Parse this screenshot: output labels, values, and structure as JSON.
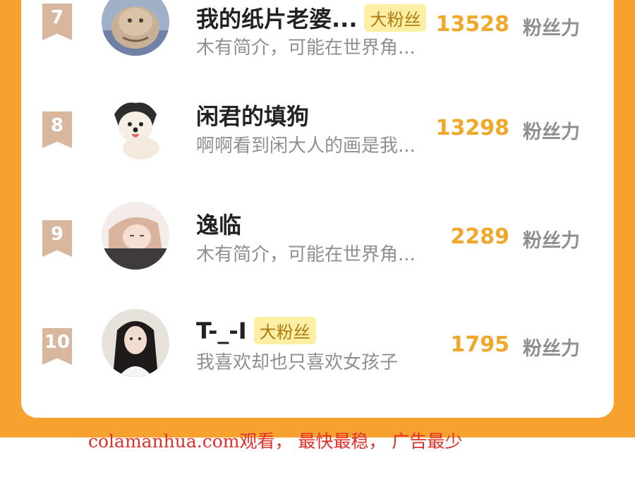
{
  "colors": {
    "frame": "#f7a12e",
    "score": "#f0a82a",
    "rank_tag": "#d8b79e",
    "badge_bg": "#fcefa4",
    "footer_text": "#e0302a"
  },
  "ranking": [
    {
      "rank": "7",
      "name": "我的纸片老婆...",
      "badge": "大粉丝",
      "desc": "木有简介，可能在世界角...",
      "score": "13528",
      "unit": "粉丝力",
      "avatar_icon": "cat-photo-avatar"
    },
    {
      "rank": "8",
      "name": "闲君的填狗",
      "badge": "",
      "desc": "啊啊看到闲大人的画是我...",
      "score": "13298",
      "unit": "粉丝力",
      "avatar_icon": "dog-drawing-avatar"
    },
    {
      "rank": "9",
      "name": "逸临",
      "badge": "",
      "desc": "木有简介，可能在世界角...",
      "score": "2289",
      "unit": "粉丝力",
      "avatar_icon": "anime-girl-avatar"
    },
    {
      "rank": "10",
      "name": "T-_-I",
      "badge": "大粉丝",
      "desc": "我喜欢却也只喜欢女孩子",
      "score": "1795",
      "unit": "粉丝力",
      "avatar_icon": "woman-photo-avatar"
    }
  ],
  "footer": {
    "text": "colamanhua.com观看， 最快最稳， 广告最少"
  }
}
